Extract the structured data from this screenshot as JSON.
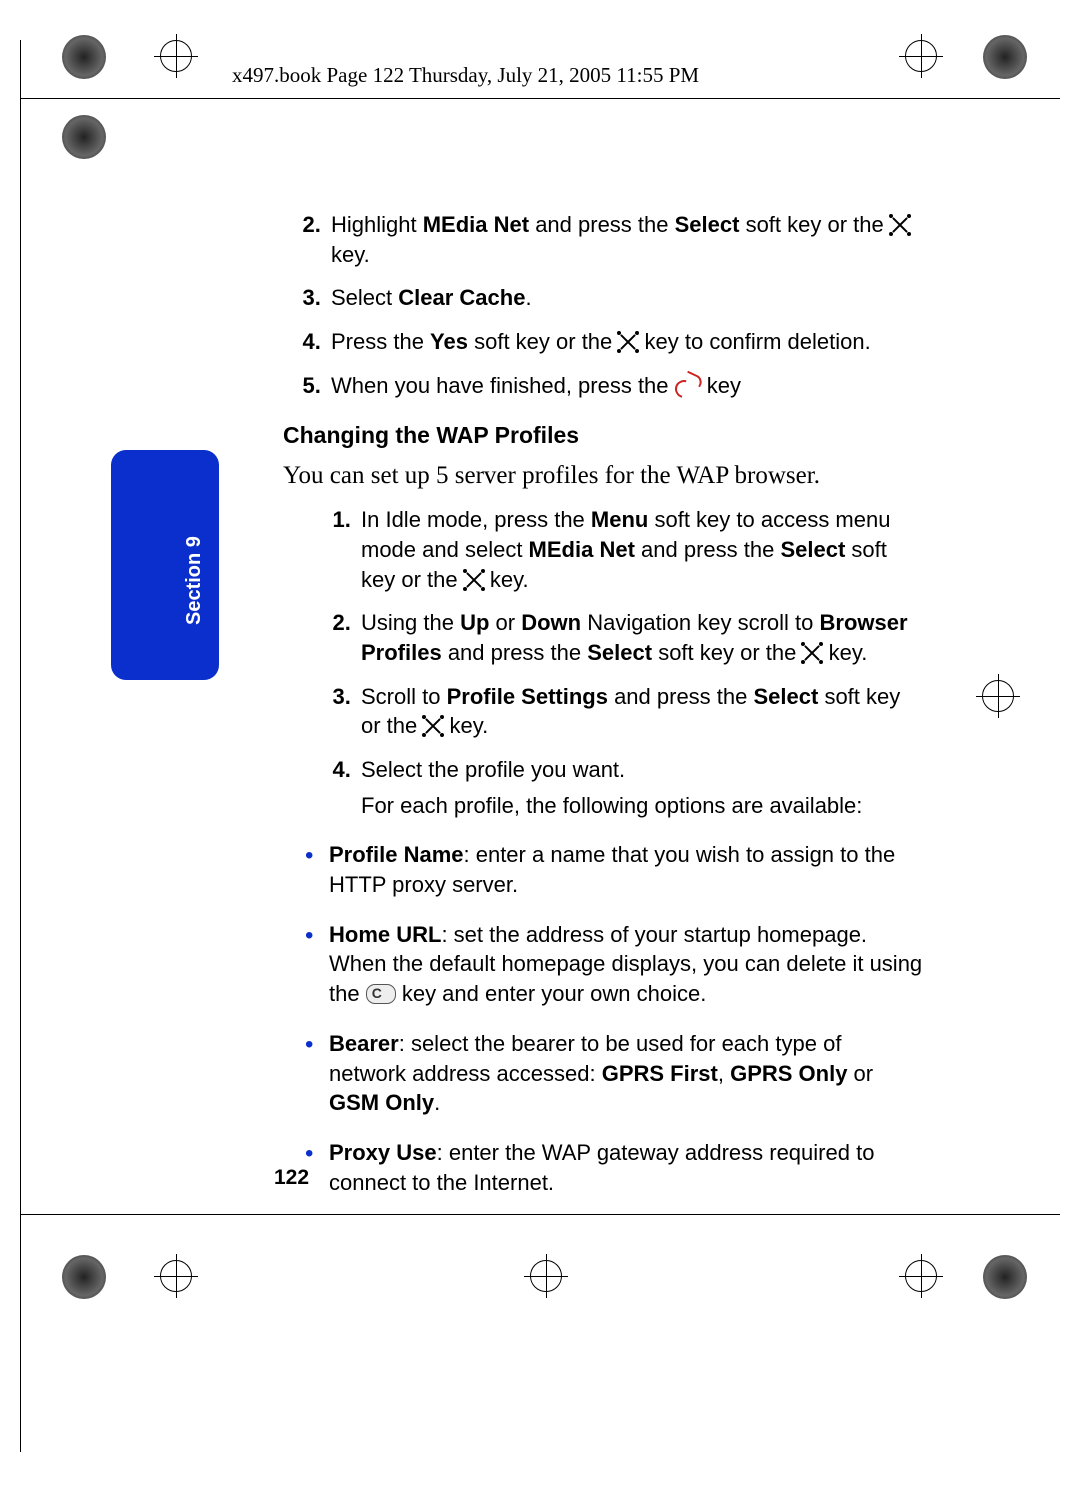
{
  "header": "x497.book  Page 122  Thursday, July 21, 2005  11:55 PM",
  "page_number": "122",
  "section_tab": "Section 9",
  "top_list_start": 2,
  "top_list": {
    "i2a": "Highlight ",
    "i2b": "MEdia Net",
    "i2c": " and press the ",
    "i2d": "Select",
    "i2e": " soft key or the ",
    "i2f": " key.",
    "i3a": "Select ",
    "i3b": "Clear Cache",
    "i3c": ".",
    "i4a": "Press the ",
    "i4b": "Yes",
    "i4c": " soft key or the ",
    "i4d": " key to confirm deletion.",
    "i5a": "When you have finished, press the ",
    "i5b": " key"
  },
  "heading": "Changing the WAP Profiles",
  "intro": "You can set up 5 server profiles for the WAP browser.",
  "second_list": {
    "s1a": "In Idle mode, press the ",
    "s1b": "Menu",
    "s1c": " soft key to access menu mode and select ",
    "s1d": "MEdia Net",
    "s1e": " and press the ",
    "s1f": "Select",
    "s1g": " soft key or the ",
    "s1h": " key.",
    "s2a": "Using the ",
    "s2b": "Up",
    "s2c": " or ",
    "s2d": "Down",
    "s2e": " Navigation key scroll to ",
    "s2f": "Browser Profiles",
    "s2g": " and press the ",
    "s2h": "Select",
    "s2i": " soft key or the ",
    "s2j": " key.",
    "s3a": "Scroll to ",
    "s3b": "Profile Settings",
    "s3c": " and press the ",
    "s3d": "Select",
    "s3e": " soft key or the ",
    "s3f": " key.",
    "s4a": "Select the profile you want.",
    "s4b": "For each profile, the following options are available:"
  },
  "bullets": {
    "b1a": "Profile Name",
    "b1b": ": enter a name that you wish to assign to the HTTP proxy server.",
    "b2a": "Home URL",
    "b2b": ": set the address of your startup homepage. When the default homepage displays, you can delete it using the ",
    "b2c": " key and enter your own choice.",
    "b3a": "Bearer",
    "b3b": ": select the bearer to be used for each type of network address accessed: ",
    "b3c": "GPRS First",
    "b3d": ", ",
    "b3e": "GPRS Only",
    "b3f": " or ",
    "b3g": "GSM Only",
    "b3h": ".",
    "b4a": "Proxy Use",
    "b4b": ": enter the WAP gateway address required to connect to the Internet."
  }
}
